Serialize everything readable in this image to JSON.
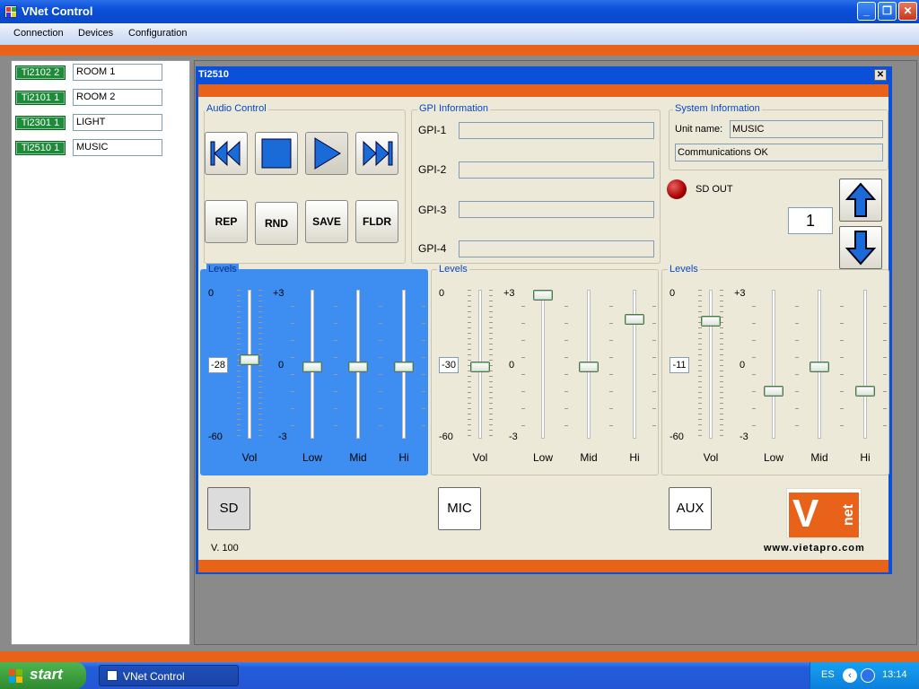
{
  "window": {
    "title": "VNet Control"
  },
  "menu": [
    "Connection",
    "Devices",
    "Configuration"
  ],
  "devices": [
    {
      "id": "Ti2102 2",
      "name": "ROOM 1"
    },
    {
      "id": "Ti2101 1",
      "name": "ROOM 2"
    },
    {
      "id": "Ti2301 1",
      "name": "LIGHT"
    },
    {
      "id": "Ti2510 1",
      "name": "MUSIC"
    }
  ],
  "child": {
    "title": "Ti2510",
    "close": "x"
  },
  "audio": {
    "label": "Audio Control",
    "buttons": [
      "REP",
      "RND",
      "SAVE",
      "FLDR"
    ]
  },
  "gpi": {
    "label": "GPI Information",
    "items": [
      "GPI-1",
      "GPI-2",
      "GPI-3",
      "GPI-4"
    ]
  },
  "system": {
    "label": "System Information",
    "unit_label": "Unit name:",
    "unit_value": "MUSIC",
    "status": "Communications OK",
    "led_label": "SD OUT",
    "counter": "1"
  },
  "levels": [
    {
      "label": "Levels",
      "vol": "-28",
      "vol_frac": 0.55,
      "low": 0.5,
      "mid": 0.5,
      "hi": 0.5,
      "selected": true,
      "source": "SD"
    },
    {
      "label": "Levels",
      "vol": "-30",
      "vol_frac": 0.5,
      "low": 1.0,
      "mid": 0.5,
      "hi": 0.83,
      "selected": false,
      "source": "MIC"
    },
    {
      "label": "Levels",
      "vol": "-11",
      "vol_frac": 0.82,
      "low": 0.33,
      "mid": 0.5,
      "hi": 0.33,
      "selected": false,
      "source": "AUX"
    }
  ],
  "scale": {
    "vol_top": "0",
    "vol_bottom": "-60",
    "eq_top": "+3",
    "eq_mid": "0",
    "eq_bottom": "-3"
  },
  "slider_labels": [
    "Vol",
    "Low",
    "Mid",
    "Hi"
  ],
  "version": "V. 100",
  "website": "www.vietapro.com",
  "logo": {
    "v": "V",
    "net": "net"
  },
  "taskbar": {
    "start": "start",
    "item": "VNet Control",
    "lang": "ES",
    "time": "13:14"
  },
  "colors": {
    "accent_orange": "#e8621a",
    "title_blue": "#0a50d8",
    "selected_levels": "#3d8ef0",
    "device_green": "#1f8a3a"
  }
}
